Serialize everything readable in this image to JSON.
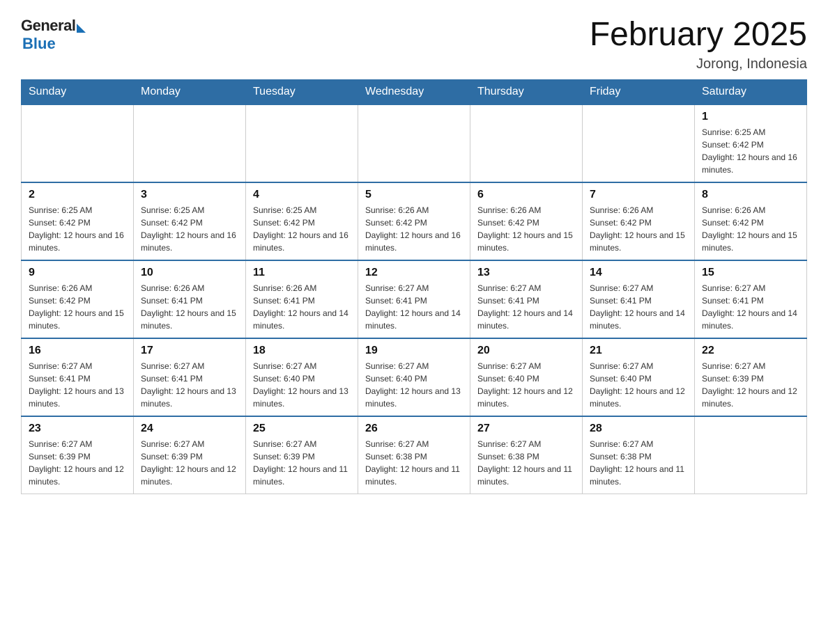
{
  "header": {
    "logo_general": "General",
    "logo_blue": "Blue",
    "title": "February 2025",
    "location": "Jorong, Indonesia"
  },
  "weekdays": [
    "Sunday",
    "Monday",
    "Tuesday",
    "Wednesday",
    "Thursday",
    "Friday",
    "Saturday"
  ],
  "weeks": [
    [
      {
        "day": "",
        "sunrise": "",
        "sunset": "",
        "daylight": ""
      },
      {
        "day": "",
        "sunrise": "",
        "sunset": "",
        "daylight": ""
      },
      {
        "day": "",
        "sunrise": "",
        "sunset": "",
        "daylight": ""
      },
      {
        "day": "",
        "sunrise": "",
        "sunset": "",
        "daylight": ""
      },
      {
        "day": "",
        "sunrise": "",
        "sunset": "",
        "daylight": ""
      },
      {
        "day": "",
        "sunrise": "",
        "sunset": "",
        "daylight": ""
      },
      {
        "day": "1",
        "sunrise": "Sunrise: 6:25 AM",
        "sunset": "Sunset: 6:42 PM",
        "daylight": "Daylight: 12 hours and 16 minutes."
      }
    ],
    [
      {
        "day": "2",
        "sunrise": "Sunrise: 6:25 AM",
        "sunset": "Sunset: 6:42 PM",
        "daylight": "Daylight: 12 hours and 16 minutes."
      },
      {
        "day": "3",
        "sunrise": "Sunrise: 6:25 AM",
        "sunset": "Sunset: 6:42 PM",
        "daylight": "Daylight: 12 hours and 16 minutes."
      },
      {
        "day": "4",
        "sunrise": "Sunrise: 6:25 AM",
        "sunset": "Sunset: 6:42 PM",
        "daylight": "Daylight: 12 hours and 16 minutes."
      },
      {
        "day": "5",
        "sunrise": "Sunrise: 6:26 AM",
        "sunset": "Sunset: 6:42 PM",
        "daylight": "Daylight: 12 hours and 16 minutes."
      },
      {
        "day": "6",
        "sunrise": "Sunrise: 6:26 AM",
        "sunset": "Sunset: 6:42 PM",
        "daylight": "Daylight: 12 hours and 15 minutes."
      },
      {
        "day": "7",
        "sunrise": "Sunrise: 6:26 AM",
        "sunset": "Sunset: 6:42 PM",
        "daylight": "Daylight: 12 hours and 15 minutes."
      },
      {
        "day": "8",
        "sunrise": "Sunrise: 6:26 AM",
        "sunset": "Sunset: 6:42 PM",
        "daylight": "Daylight: 12 hours and 15 minutes."
      }
    ],
    [
      {
        "day": "9",
        "sunrise": "Sunrise: 6:26 AM",
        "sunset": "Sunset: 6:42 PM",
        "daylight": "Daylight: 12 hours and 15 minutes."
      },
      {
        "day": "10",
        "sunrise": "Sunrise: 6:26 AM",
        "sunset": "Sunset: 6:41 PM",
        "daylight": "Daylight: 12 hours and 15 minutes."
      },
      {
        "day": "11",
        "sunrise": "Sunrise: 6:26 AM",
        "sunset": "Sunset: 6:41 PM",
        "daylight": "Daylight: 12 hours and 14 minutes."
      },
      {
        "day": "12",
        "sunrise": "Sunrise: 6:27 AM",
        "sunset": "Sunset: 6:41 PM",
        "daylight": "Daylight: 12 hours and 14 minutes."
      },
      {
        "day": "13",
        "sunrise": "Sunrise: 6:27 AM",
        "sunset": "Sunset: 6:41 PM",
        "daylight": "Daylight: 12 hours and 14 minutes."
      },
      {
        "day": "14",
        "sunrise": "Sunrise: 6:27 AM",
        "sunset": "Sunset: 6:41 PM",
        "daylight": "Daylight: 12 hours and 14 minutes."
      },
      {
        "day": "15",
        "sunrise": "Sunrise: 6:27 AM",
        "sunset": "Sunset: 6:41 PM",
        "daylight": "Daylight: 12 hours and 14 minutes."
      }
    ],
    [
      {
        "day": "16",
        "sunrise": "Sunrise: 6:27 AM",
        "sunset": "Sunset: 6:41 PM",
        "daylight": "Daylight: 12 hours and 13 minutes."
      },
      {
        "day": "17",
        "sunrise": "Sunrise: 6:27 AM",
        "sunset": "Sunset: 6:41 PM",
        "daylight": "Daylight: 12 hours and 13 minutes."
      },
      {
        "day": "18",
        "sunrise": "Sunrise: 6:27 AM",
        "sunset": "Sunset: 6:40 PM",
        "daylight": "Daylight: 12 hours and 13 minutes."
      },
      {
        "day": "19",
        "sunrise": "Sunrise: 6:27 AM",
        "sunset": "Sunset: 6:40 PM",
        "daylight": "Daylight: 12 hours and 13 minutes."
      },
      {
        "day": "20",
        "sunrise": "Sunrise: 6:27 AM",
        "sunset": "Sunset: 6:40 PM",
        "daylight": "Daylight: 12 hours and 12 minutes."
      },
      {
        "day": "21",
        "sunrise": "Sunrise: 6:27 AM",
        "sunset": "Sunset: 6:40 PM",
        "daylight": "Daylight: 12 hours and 12 minutes."
      },
      {
        "day": "22",
        "sunrise": "Sunrise: 6:27 AM",
        "sunset": "Sunset: 6:39 PM",
        "daylight": "Daylight: 12 hours and 12 minutes."
      }
    ],
    [
      {
        "day": "23",
        "sunrise": "Sunrise: 6:27 AM",
        "sunset": "Sunset: 6:39 PM",
        "daylight": "Daylight: 12 hours and 12 minutes."
      },
      {
        "day": "24",
        "sunrise": "Sunrise: 6:27 AM",
        "sunset": "Sunset: 6:39 PM",
        "daylight": "Daylight: 12 hours and 12 minutes."
      },
      {
        "day": "25",
        "sunrise": "Sunrise: 6:27 AM",
        "sunset": "Sunset: 6:39 PM",
        "daylight": "Daylight: 12 hours and 11 minutes."
      },
      {
        "day": "26",
        "sunrise": "Sunrise: 6:27 AM",
        "sunset": "Sunset: 6:38 PM",
        "daylight": "Daylight: 12 hours and 11 minutes."
      },
      {
        "day": "27",
        "sunrise": "Sunrise: 6:27 AM",
        "sunset": "Sunset: 6:38 PM",
        "daylight": "Daylight: 12 hours and 11 minutes."
      },
      {
        "day": "28",
        "sunrise": "Sunrise: 6:27 AM",
        "sunset": "Sunset: 6:38 PM",
        "daylight": "Daylight: 12 hours and 11 minutes."
      },
      {
        "day": "",
        "sunrise": "",
        "sunset": "",
        "daylight": ""
      }
    ]
  ]
}
